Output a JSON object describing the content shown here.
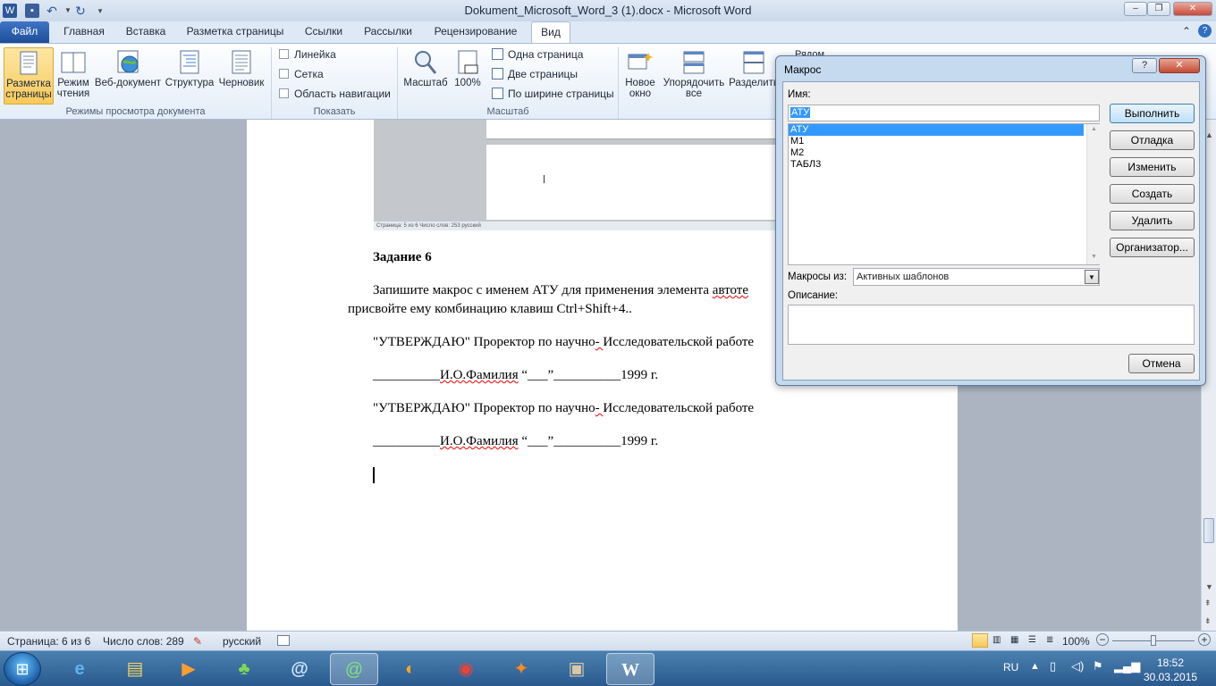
{
  "window": {
    "title": "Dokument_Microsoft_Word_3 (1).docx - Microsoft Word",
    "minimize": "‒",
    "maximize": "❐",
    "close": "✕"
  },
  "ribbon_tabs": [
    "Файл",
    "Главная",
    "Вставка",
    "Разметка страницы",
    "Ссылки",
    "Рассылки",
    "Рецензирование",
    "Вид"
  ],
  "ribbon": {
    "views": {
      "buttons": [
        {
          "label1": "Разметка",
          "label2": "страницы"
        },
        {
          "label1": "Режим",
          "label2": "чтения"
        },
        {
          "label1": "Веб-документ",
          "label2": ""
        },
        {
          "label1": "Структура",
          "label2": ""
        },
        {
          "label1": "Черновик",
          "label2": ""
        }
      ],
      "group_label": "Режимы просмотра документа"
    },
    "show": {
      "items": [
        "Линейка",
        "Сетка",
        "Область навигации"
      ],
      "group_label": "Показать"
    },
    "zoom": {
      "zoom_label": "Масштаб",
      "percent_label": "100%",
      "one_page": "Одна страница",
      "two_pages": "Две страницы",
      "page_width": "По ширине страницы",
      "group_label": "Масштаб"
    },
    "window": {
      "new_window": [
        "Новое",
        "окно"
      ],
      "arrange": [
        "Упорядочить",
        "все"
      ],
      "split": "Разделить",
      "side_by_side": "Рядом"
    }
  },
  "document": {
    "embedded_status": "Страница: 5 из 6   Число слов: 253   русский",
    "heading": "Задание 6",
    "para1_line1_a": "Запишите макрос с именем АТУ для применения элемента ",
    "para1_line1_b": "автоте",
    "para1_line2": "присвойте ему комбинацию клавиш Ctrl+Shift+4..",
    "approve1": "\"УТВЕРЖДАЮ\"  Проректор по научно",
    "approve1_dash": "- ",
    "approve1_b": "Исследовательской работе",
    "sign1_a": "__________",
    "sign1_b": "И.О.Фамилия",
    "sign1_c": " “___”__________1999 г.",
    "approve2": "\"УТВЕРЖДАЮ\"  Проректор по научно",
    "approve2_dash": "- ",
    "approve2_b": "Исследовательской работе",
    "sign2_a": "__________",
    "sign2_b": "И.О.Фамилия",
    "sign2_c": " “___”__________1999 г."
  },
  "status_bar": {
    "page": "Страница: 6 из 6",
    "words": "Число слов: 289",
    "language": "русский",
    "zoom": "100%",
    "zoom_minus": "−",
    "zoom_plus": "+"
  },
  "macro_dialog": {
    "title": "Макрос",
    "help": "?",
    "close": "✕",
    "name_label": "Имя:",
    "name_value": "АТУ",
    "macros": [
      "АТУ",
      "М1",
      "М2",
      "ТАБЛ3"
    ],
    "selected_macro": "АТУ",
    "buttons": {
      "run": "Выполнить",
      "debug": "Отладка",
      "edit": "Изменить",
      "create": "Создать",
      "delete": "Удалить",
      "organizer": "Организатор...",
      "cancel": "Отмена"
    },
    "macros_in_label": "Макросы из:",
    "macros_in_value": "Активных шаблонов",
    "description_label": "Описание:",
    "description_value": ""
  },
  "taskbar": {
    "lang": "RU",
    "time": "18:52",
    "date": "30.03.2015",
    "apps": [
      "ie-icon",
      "explorer-icon",
      "media-player-icon",
      "messenger-icon",
      "mail-at-icon",
      "agent-icon",
      "app-icon",
      "chrome-icon",
      "avast-icon",
      "archive-icon",
      "word-icon"
    ]
  }
}
